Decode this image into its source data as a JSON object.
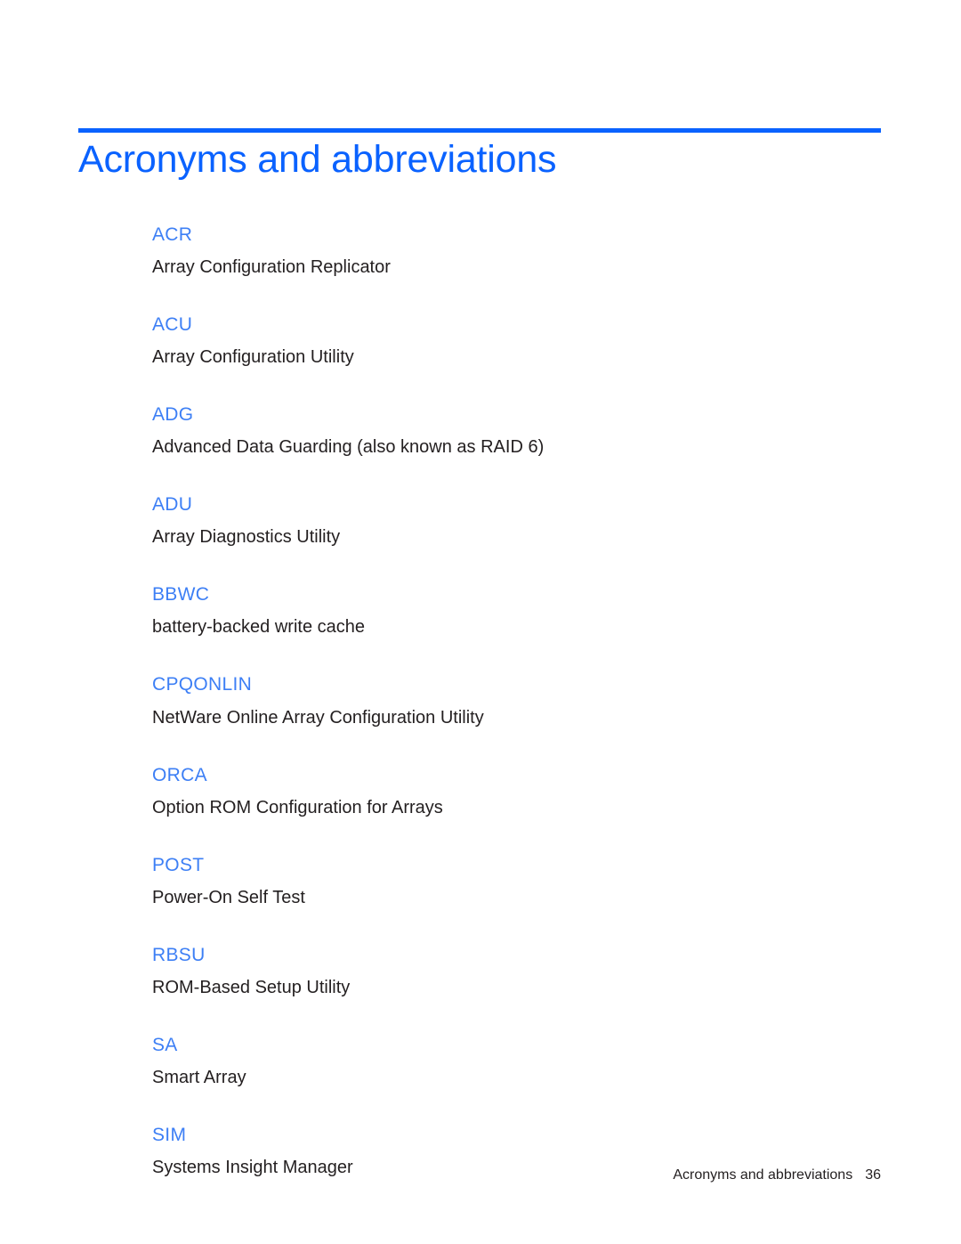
{
  "document": {
    "title": "Acronyms and abbreviations",
    "accent_color": "#0a62ff",
    "term_color": "#3d7ff5",
    "body_color": "#231f20"
  },
  "glossary": {
    "entries": [
      {
        "term": "ACR",
        "definition": "Array Configuration Replicator"
      },
      {
        "term": "ACU",
        "definition": "Array Configuration Utility"
      },
      {
        "term": "ADG",
        "definition": "Advanced Data Guarding (also known as RAID 6)"
      },
      {
        "term": "ADU",
        "definition": "Array Diagnostics Utility"
      },
      {
        "term": "BBWC",
        "definition": "battery-backed write cache"
      },
      {
        "term": "CPQONLIN",
        "definition": "NetWare Online Array Configuration Utility"
      },
      {
        "term": "ORCA",
        "definition": "Option ROM Configuration for Arrays"
      },
      {
        "term": "POST",
        "definition": "Power-On Self Test"
      },
      {
        "term": "RBSU",
        "definition": "ROM-Based Setup Utility"
      },
      {
        "term": "SA",
        "definition": "Smart Array"
      },
      {
        "term": "SIM",
        "definition": "Systems Insight Manager"
      }
    ]
  },
  "footer": {
    "label": "Acronyms and abbreviations",
    "page_number": "36"
  }
}
